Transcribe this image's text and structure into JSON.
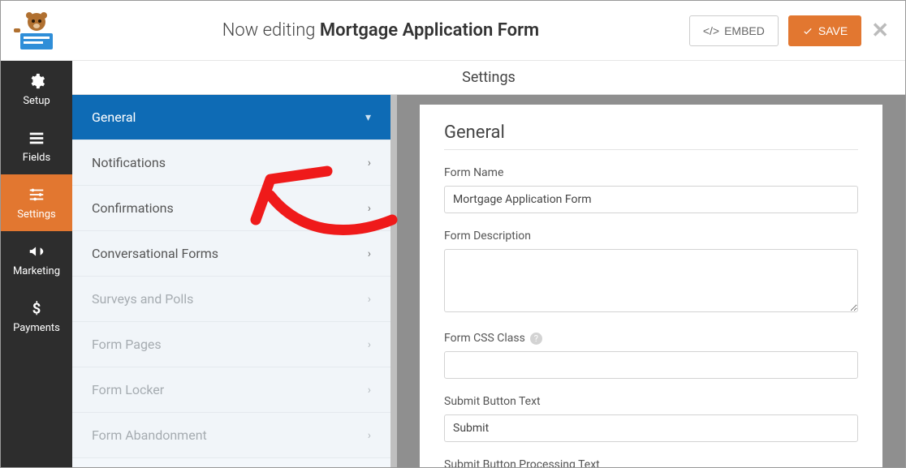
{
  "header": {
    "now_editing_prefix": "Now editing ",
    "form_title": "Mortgage Application Form",
    "embed_label": "EMBED",
    "save_label": "SAVE"
  },
  "sidebar": {
    "items": [
      {
        "label": "Setup",
        "active": false
      },
      {
        "label": "Fields",
        "active": false
      },
      {
        "label": "Settings",
        "active": true
      },
      {
        "label": "Marketing",
        "active": false
      },
      {
        "label": "Payments",
        "active": false
      }
    ]
  },
  "settings_menu": {
    "title": "Settings",
    "items": [
      {
        "label": "General",
        "active": true,
        "muted": false,
        "expand": true
      },
      {
        "label": "Notifications",
        "active": false,
        "muted": false,
        "expand": false
      },
      {
        "label": "Confirmations",
        "active": false,
        "muted": false,
        "expand": false
      },
      {
        "label": "Conversational Forms",
        "active": false,
        "muted": false,
        "expand": false
      },
      {
        "label": "Surveys and Polls",
        "active": false,
        "muted": true,
        "expand": false
      },
      {
        "label": "Form Pages",
        "active": false,
        "muted": true,
        "expand": false
      },
      {
        "label": "Form Locker",
        "active": false,
        "muted": true,
        "expand": false
      },
      {
        "label": "Form Abandonment",
        "active": false,
        "muted": true,
        "expand": false
      }
    ]
  },
  "panel": {
    "heading": "General",
    "form_name_label": "Form Name",
    "form_name_value": "Mortgage Application Form",
    "form_description_label": "Form Description",
    "form_description_value": "",
    "form_css_label": "Form CSS Class",
    "form_css_value": "",
    "submit_text_label": "Submit Button Text",
    "submit_text_value": "Submit",
    "submit_processing_label": "Submit Button Processing Text"
  },
  "colors": {
    "accent_orange": "#e27730",
    "accent_blue": "#0e6bb5",
    "sidebar_bg": "#2d2d2d"
  }
}
